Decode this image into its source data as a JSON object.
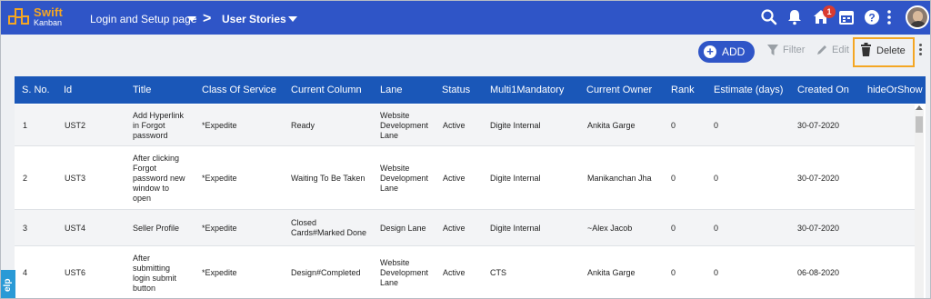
{
  "brand": {
    "name": "Swift",
    "sub": "Kanban"
  },
  "breadcrumb": {
    "project": "Login and Setup page",
    "view": "User Stories"
  },
  "notifications": {
    "home_badge": "1"
  },
  "toolbar": {
    "add_label": "ADD",
    "filter_label": "Filter",
    "edit_label": "Edit",
    "delete_label": "Delete"
  },
  "table": {
    "columns": [
      "S. No.",
      "Id",
      "Title",
      "Class Of Service",
      "Current Column",
      "Lane",
      "Status",
      "Multi1Mandatory",
      "Current Owner",
      "Rank",
      "Estimate (days)",
      "Created On",
      "hideOrShow"
    ],
    "rows": [
      {
        "sno": "1",
        "id": "UST2",
        "title": [
          "Add Hyperlink",
          "in Forgot",
          "password"
        ],
        "cos": "*Expedite",
        "column": [
          "Ready"
        ],
        "lane": [
          "Website",
          "Development",
          "Lane"
        ],
        "status": "Active",
        "multi": "Digite Internal",
        "owner": "Ankita Garge",
        "rank": "0",
        "estimate": "0",
        "created": "30-07-2020"
      },
      {
        "sno": "2",
        "id": "UST3",
        "title": [
          "After clicking",
          "Forgot",
          "password new",
          "window to",
          "open"
        ],
        "cos": "*Expedite",
        "column": [
          "Waiting To Be Taken"
        ],
        "lane": [
          "Website",
          "Development",
          "Lane"
        ],
        "status": "Active",
        "multi": "Digite Internal",
        "owner": "Manikanchan Jha",
        "rank": "0",
        "estimate": "0",
        "created": "30-07-2020"
      },
      {
        "sno": "3",
        "id": "UST4",
        "title": [
          "Seller Profile"
        ],
        "cos": "*Expedite",
        "column": [
          "Closed",
          "Cards#Marked Done"
        ],
        "lane": [
          "Design Lane"
        ],
        "status": "Active",
        "multi": "Digite Internal",
        "owner": "~Alex Jacob",
        "rank": "0",
        "estimate": "0",
        "created": "30-07-2020"
      },
      {
        "sno": "4",
        "id": "UST6",
        "title": [
          "After",
          "submitting",
          "login submit",
          "button"
        ],
        "cos": "*Expedite",
        "column": [
          "Design#Completed"
        ],
        "lane": [
          "Website",
          "Development",
          "Lane"
        ],
        "status": "Active",
        "multi": "CTS",
        "owner": "Ankita Garge",
        "rank": "0",
        "estimate": "0",
        "created": "06-08-2020"
      }
    ]
  },
  "help": {
    "label": "elp"
  },
  "colors": {
    "topbar": "#2f55c7",
    "header": "#1a57b8",
    "accent": "#f4a623",
    "badge": "#d93b30"
  },
  "icons": [
    "search-icon",
    "bell-icon",
    "home-icon",
    "calendar-icon",
    "help-icon",
    "kebab-icon",
    "filter-icon",
    "edit-icon",
    "trash-icon"
  ]
}
